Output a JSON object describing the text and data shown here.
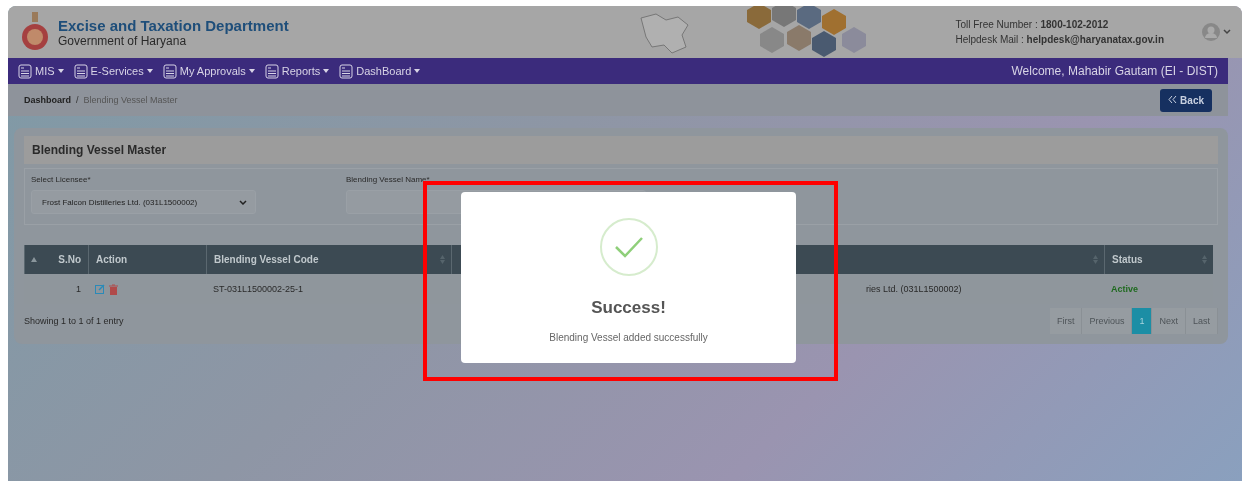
{
  "header": {
    "title": "Excise and Taxation Department",
    "subtitle": "Government of Haryana",
    "toll_free": "Toll Free Number : **1800-102-2012**",
    "helpdesk": "Helpdesk Mail : **helpdesk@haryanatax.gov.in**"
  },
  "menu": [
    {
      "label": "MIS"
    },
    {
      "label": "E-Services"
    },
    {
      "label": "My Approvals"
    },
    {
      "label": "Reports"
    },
    {
      "label": "DashBoard"
    }
  ],
  "welcome": "Welcome, Mahabir Gautam (EI - DIST)",
  "breadcrumb": [
    {
      "label": "Dashboard",
      "current": false
    },
    {
      "label": "Blending Vessel Master",
      "current": true
    }
  ],
  "breadcrumb_separator": "/",
  "back_button": "Back",
  "card": {
    "title": "Blending Vessel Master",
    "fields": [
      {
        "kind": "select",
        "label": "Select Licensee*",
        "value": "Frost Falcon Distilleries Ltd. (031L1500002)"
      },
      {
        "kind": "input",
        "label": "Blending Vessel Name*"
      }
    ]
  },
  "table": {
    "columns": [
      {
        "label": "S.No",
        "sortable": true
      },
      {
        "label": "Action",
        "sortable": false
      },
      {
        "label": "Blending Vessel Code",
        "sortable": true
      },
      {},
      {
        "sortable": true
      },
      {
        "label": "Status",
        "sortable": true
      }
    ],
    "rows": [
      {
        "s_no": "1",
        "code": "ST-031L1500002-25-1",
        "column_5": "ries Ltd. (031L1500002)",
        "status": "Active"
      }
    ]
  },
  "footer": "Showing 1 to 1 of 1 entry",
  "pagination": [
    {
      "label": "First",
      "selected": false
    },
    {
      "label": "Previous",
      "selected": false
    },
    {
      "label": "1",
      "selected": true
    },
    {
      "label": "Next",
      "selected": false
    },
    {
      "label": "Last",
      "selected": false
    }
  ],
  "modal": {
    "title": "Success!",
    "message": "Blending Vessel added successfully"
  }
}
